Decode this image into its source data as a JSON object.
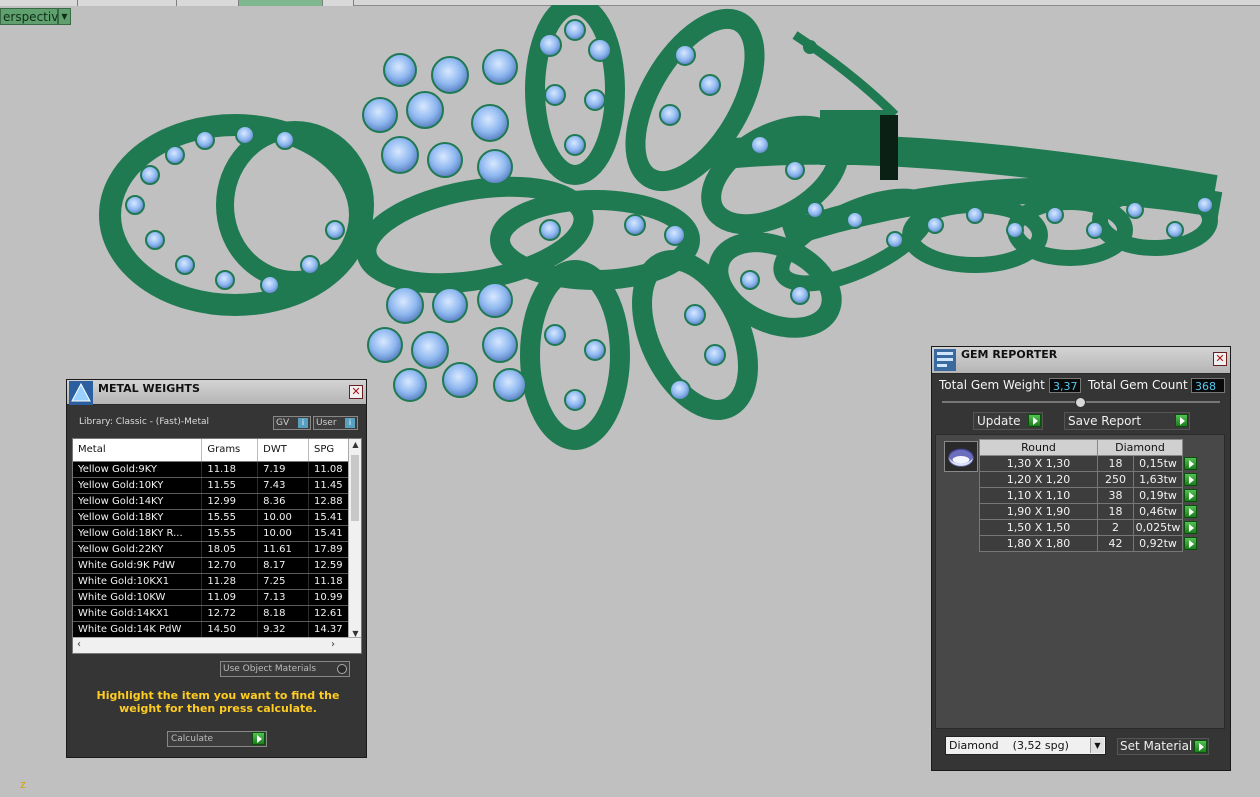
{
  "viewport": {
    "label": "erspective",
    "dropdown_icon": "triangle-down"
  },
  "metal_weights": {
    "title": "METAL WEIGHTS",
    "library_label": "Library: Classic - (Fast)-Metal",
    "gv_label": "GV",
    "user_label": "User",
    "columns": [
      "Metal",
      "Grams",
      "DWT",
      "SPG"
    ],
    "rows": [
      [
        "Yellow Gold:9KY",
        "11.18",
        "7.19",
        "11.08"
      ],
      [
        "Yellow Gold:10KY",
        "11.55",
        "7.43",
        "11.45"
      ],
      [
        "Yellow Gold:14KY",
        "12.99",
        "8.36",
        "12.88"
      ],
      [
        "Yellow Gold:18KY",
        "15.55",
        "10.00",
        "15.41"
      ],
      [
        "Yellow Gold:18KY R...",
        "15.55",
        "10.00",
        "15.41"
      ],
      [
        "Yellow Gold:22KY",
        "18.05",
        "11.61",
        "17.89"
      ],
      [
        "White Gold:9K PdW",
        "12.70",
        "8.17",
        "12.59"
      ],
      [
        "White Gold:10KX1",
        "11.28",
        "7.25",
        "11.18"
      ],
      [
        "White Gold:10KW",
        "11.09",
        "7.13",
        "10.99"
      ],
      [
        "White Gold:14KX1",
        "12.72",
        "8.18",
        "12.61"
      ],
      [
        "White Gold:14K PdW",
        "14.50",
        "9.32",
        "14.37"
      ]
    ],
    "use_object_materials": "Use Object Materials",
    "hint": "Highlight the item you want to find the weight for then press calculate.",
    "calculate_label": "Calculate"
  },
  "gem_reporter": {
    "title": "GEM REPORTER",
    "total_weight_label": "Total Gem Weight",
    "total_weight_value": "3,37",
    "total_count_label": "Total Gem Count",
    "total_count_value": "368",
    "update_label": "Update",
    "save_report_label": "Save Report",
    "columns": [
      "Round",
      "Diamond"
    ],
    "rows": [
      [
        "1,30 X 1,30",
        "18",
        "0,15tw"
      ],
      [
        "1,20 X 1,20",
        "250",
        "1,63tw"
      ],
      [
        "1,10 X 1,10",
        "38",
        "0,19tw"
      ],
      [
        "1,90 X 1,90",
        "18",
        "0,46tw"
      ],
      [
        "1,50 X 1,50",
        "2",
        "0,025tw"
      ],
      [
        "1,80 X 1,80",
        "42",
        "0,92tw"
      ]
    ],
    "material_value": "Diamond    (3,52 spg)",
    "set_material_label": "Set Material"
  },
  "axis_label": "z",
  "colors": {
    "metal": "#1f7a52",
    "gem": "#8fb8f0",
    "panel_bg": "#353535",
    "hint_text": "#ffcc22",
    "value_text": "#58c8f0"
  }
}
